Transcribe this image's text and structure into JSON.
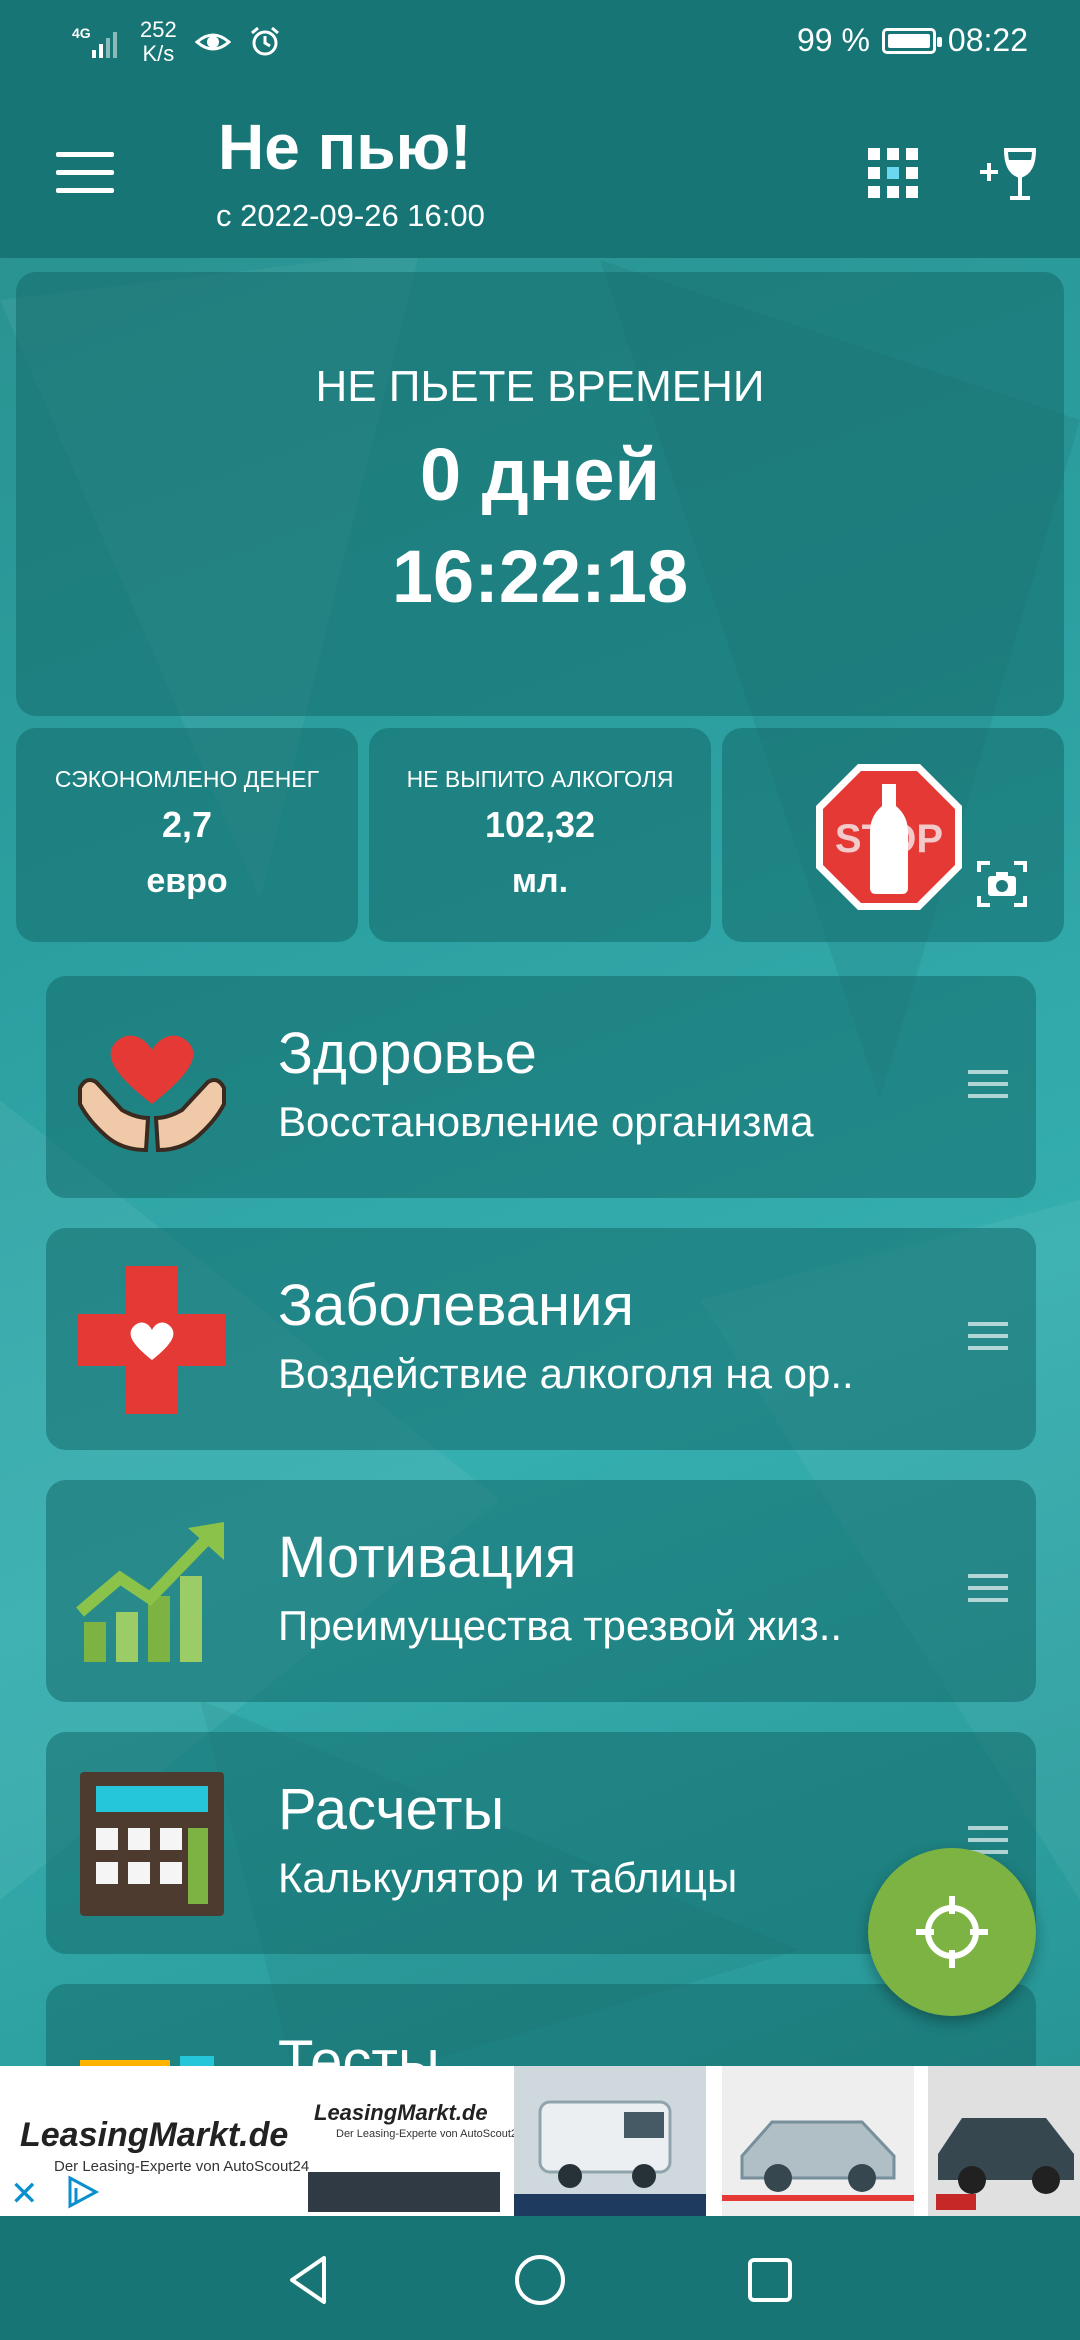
{
  "status_bar": {
    "network": "4G",
    "speed_value": "252",
    "speed_unit": "K/s",
    "battery": "99 %",
    "time": "08:22"
  },
  "app_bar": {
    "title": "Не пью!",
    "subtitle": "с 2022-09-26 16:00"
  },
  "timer": {
    "label": "НЕ ПЬЕТЕ ВРЕМЕНИ",
    "days": "0 дней",
    "time": "16:22:18"
  },
  "stats": [
    {
      "label": "СЭКОНОМЛЕНО ДЕНЕГ",
      "value": "2,7",
      "unit": "евро"
    },
    {
      "label": "НЕ ВЫПИТО АЛКОГОЛЯ",
      "value": "102,32",
      "unit": "мл."
    }
  ],
  "stop_sign_text": "STOP",
  "menu_items": [
    {
      "title": "Здоровье",
      "description": "Восстановление организма",
      "icon": "heart-hands-icon"
    },
    {
      "title": "Заболевания",
      "description": "Воздействие алкоголя на ор..",
      "icon": "medical-cross-icon"
    },
    {
      "title": "Мотивация",
      "description": "Преимущества трезвой жиз..",
      "icon": "growth-chart-icon"
    },
    {
      "title": "Расчеты",
      "description": "Калькулятор и таблицы",
      "icon": "calculator-icon"
    },
    {
      "title": "Тесты",
      "description": "",
      "icon": "tests-icon"
    }
  ],
  "ad": {
    "brand": "LeasingMarkt.de",
    "tagline": "Der Leasing-Experte von AutoScout24"
  },
  "colors": {
    "bar": "#177575",
    "fab": "#7cb342",
    "heart": "#e53935"
  }
}
